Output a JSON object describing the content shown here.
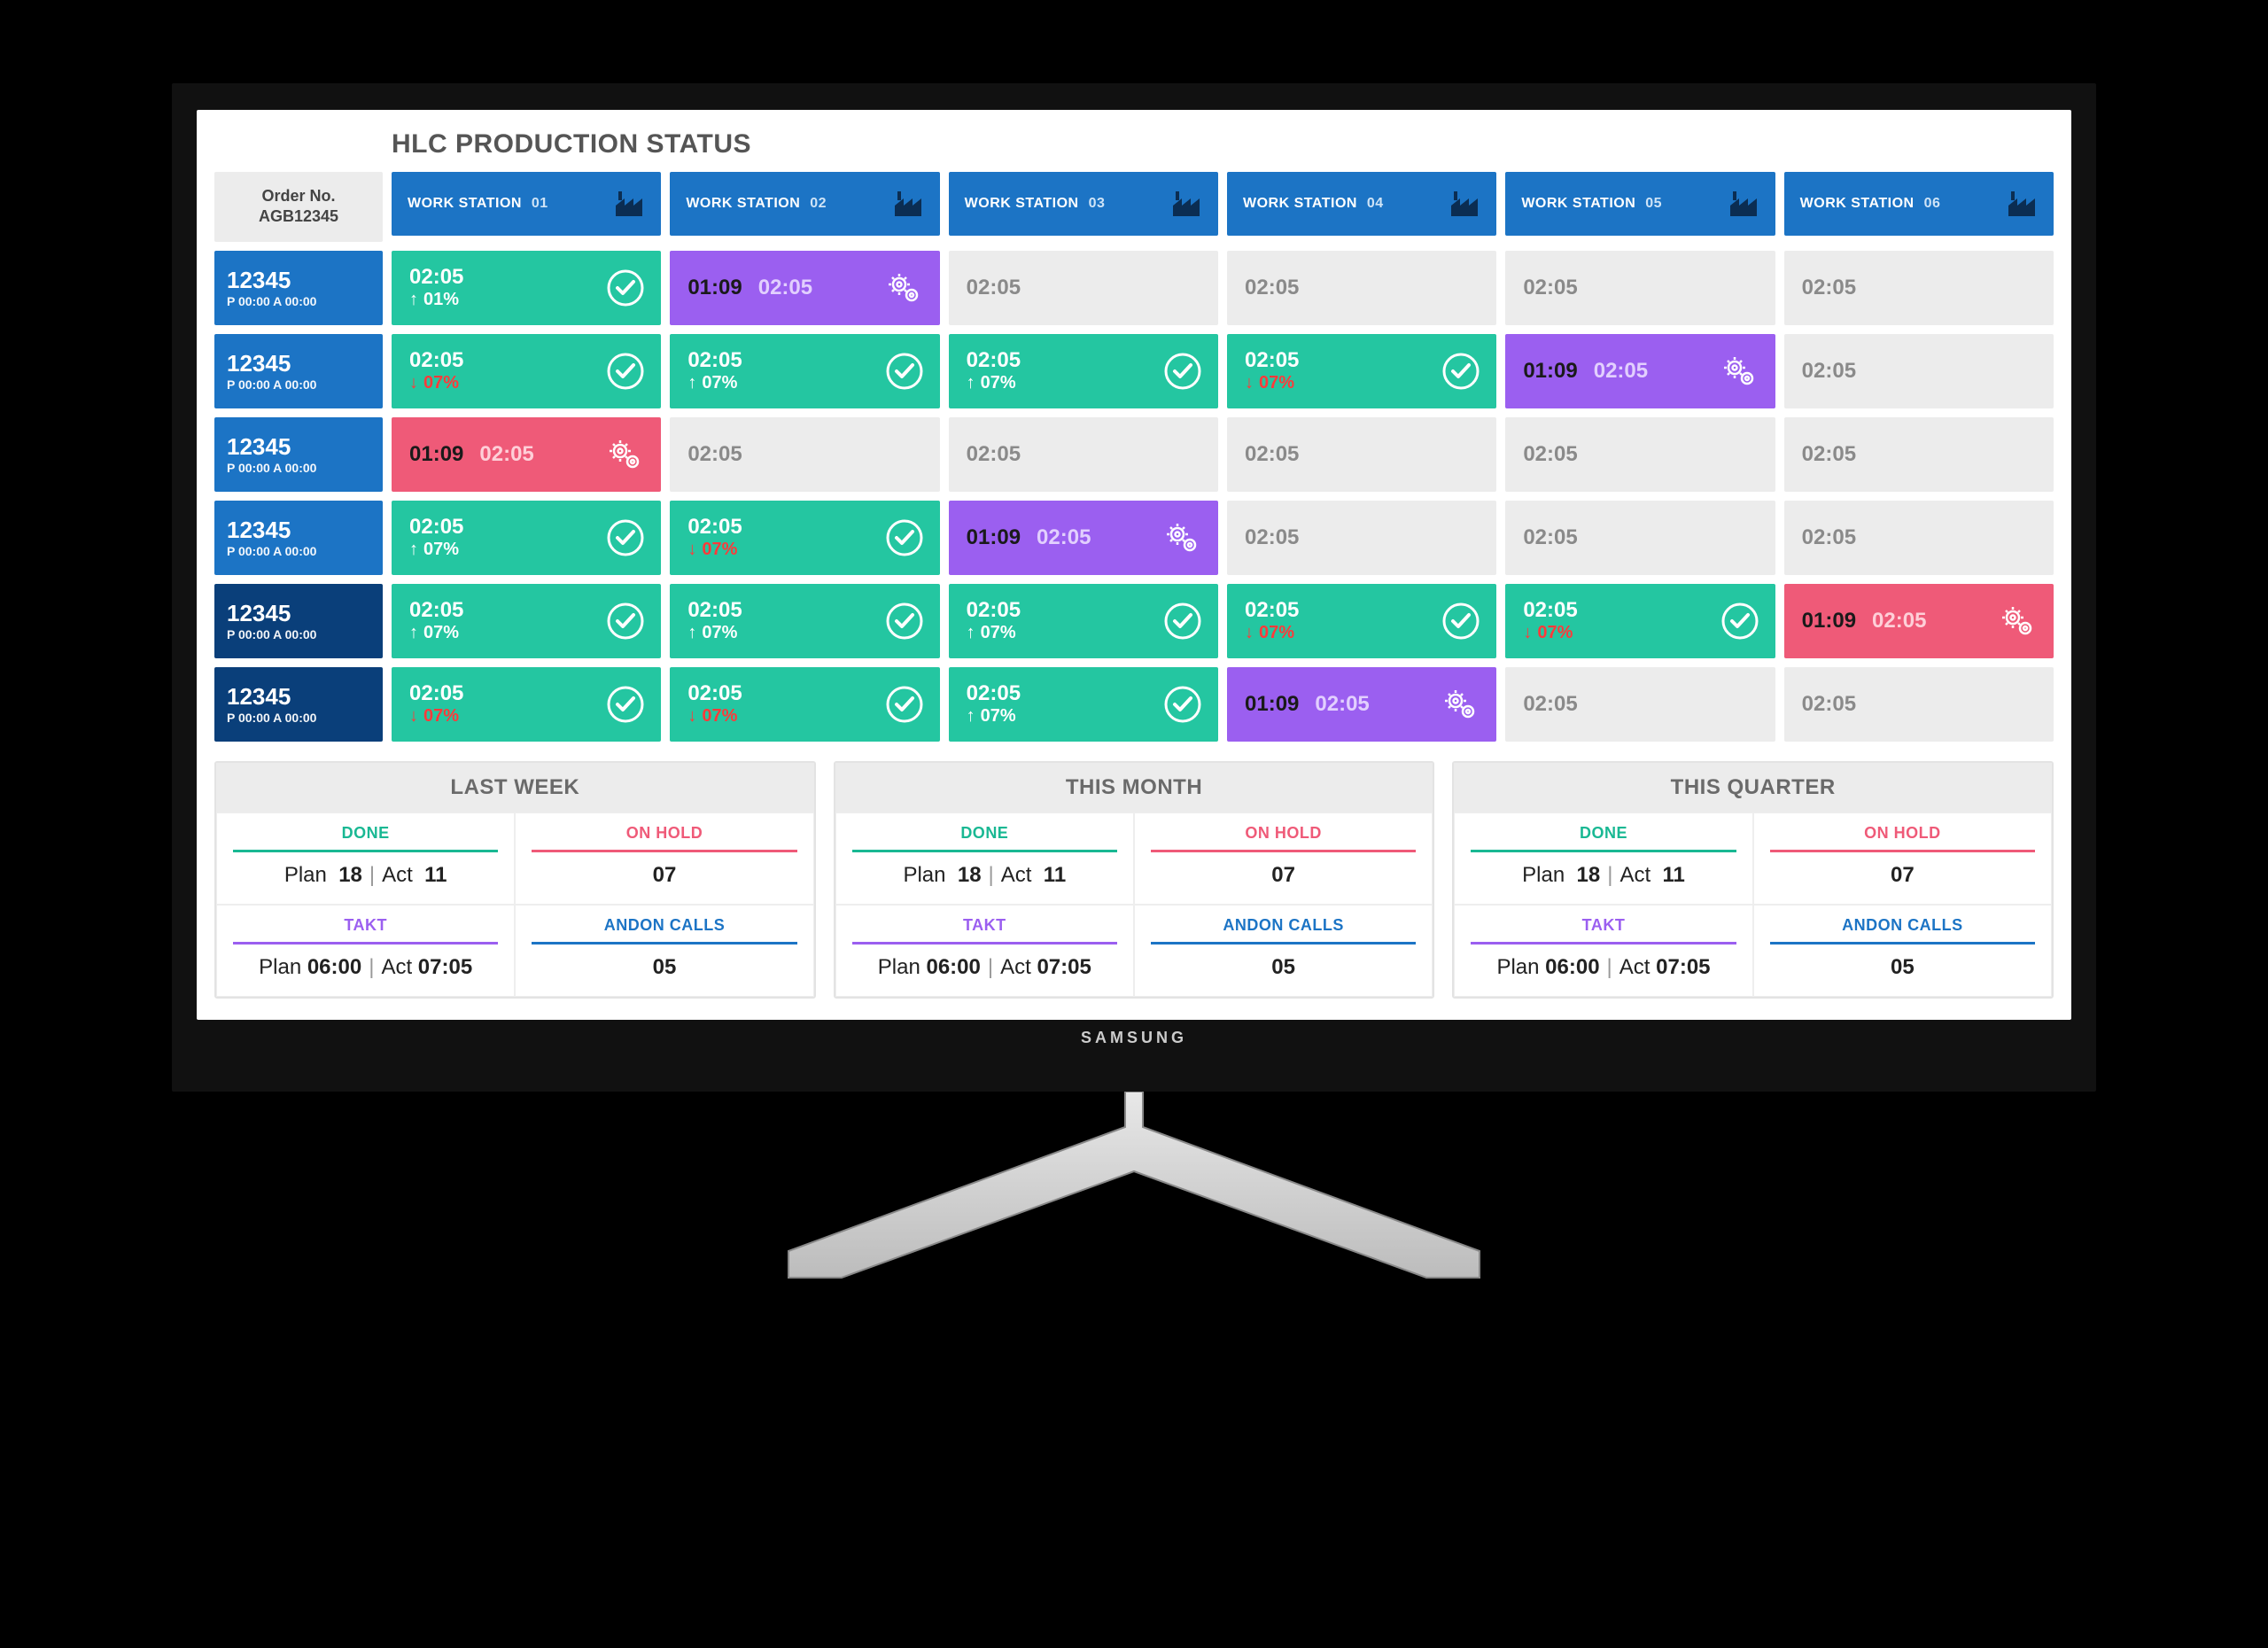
{
  "title": "HLC PRODUCTION STATUS",
  "orderHeader": {
    "l1": "Order No.",
    "l2": "AGB12345"
  },
  "stations": [
    {
      "label": "WORK STATION",
      "num": "01"
    },
    {
      "label": "WORK STATION",
      "num": "02"
    },
    {
      "label": "WORK STATION",
      "num": "03"
    },
    {
      "label": "WORK STATION",
      "num": "04"
    },
    {
      "label": "WORK STATION",
      "num": "05"
    },
    {
      "label": "WORK STATION",
      "num": "06"
    }
  ],
  "rows": [
    {
      "dark": false,
      "id": "12345",
      "sub": "P 00:00 A 00:00",
      "cells": [
        {
          "type": "green",
          "time": "02:05",
          "pct": "01%",
          "dir": "up"
        },
        {
          "type": "purple",
          "a": "01:09",
          "b": "02:05"
        },
        {
          "type": "idle",
          "time": "02:05"
        },
        {
          "type": "idle",
          "time": "02:05"
        },
        {
          "type": "idle",
          "time": "02:05"
        },
        {
          "type": "idle",
          "time": "02:05"
        }
      ]
    },
    {
      "dark": false,
      "id": "12345",
      "sub": "P 00:00 A 00:00",
      "cells": [
        {
          "type": "green",
          "time": "02:05",
          "pct": "07%",
          "dir": "down"
        },
        {
          "type": "green",
          "time": "02:05",
          "pct": "07%",
          "dir": "up"
        },
        {
          "type": "green",
          "time": "02:05",
          "pct": "07%",
          "dir": "up"
        },
        {
          "type": "green",
          "time": "02:05",
          "pct": "07%",
          "dir": "down"
        },
        {
          "type": "purple",
          "a": "01:09",
          "b": "02:05"
        },
        {
          "type": "idle",
          "time": "02:05"
        }
      ]
    },
    {
      "dark": false,
      "id": "12345",
      "sub": "P 00:00 A 00:00",
      "cells": [
        {
          "type": "red",
          "a": "01:09",
          "b": "02:05"
        },
        {
          "type": "idle",
          "time": "02:05"
        },
        {
          "type": "idle",
          "time": "02:05"
        },
        {
          "type": "idle",
          "time": "02:05"
        },
        {
          "type": "idle",
          "time": "02:05"
        },
        {
          "type": "idle",
          "time": "02:05"
        }
      ]
    },
    {
      "dark": false,
      "id": "12345",
      "sub": "P 00:00 A 00:00",
      "cells": [
        {
          "type": "green",
          "time": "02:05",
          "pct": "07%",
          "dir": "up"
        },
        {
          "type": "green",
          "time": "02:05",
          "pct": "07%",
          "dir": "down"
        },
        {
          "type": "purple",
          "a": "01:09",
          "b": "02:05"
        },
        {
          "type": "idle",
          "time": "02:05"
        },
        {
          "type": "idle",
          "time": "02:05"
        },
        {
          "type": "idle",
          "time": "02:05"
        }
      ]
    },
    {
      "dark": true,
      "id": "12345",
      "sub": "P 00:00 A 00:00",
      "cells": [
        {
          "type": "green",
          "time": "02:05",
          "pct": "07%",
          "dir": "up"
        },
        {
          "type": "green",
          "time": "02:05",
          "pct": "07%",
          "dir": "up"
        },
        {
          "type": "green",
          "time": "02:05",
          "pct": "07%",
          "dir": "up"
        },
        {
          "type": "green",
          "time": "02:05",
          "pct": "07%",
          "dir": "down"
        },
        {
          "type": "green",
          "time": "02:05",
          "pct": "07%",
          "dir": "down"
        },
        {
          "type": "red",
          "a": "01:09",
          "b": "02:05"
        }
      ]
    },
    {
      "dark": true,
      "id": "12345",
      "sub": "P 00:00 A 00:00",
      "cells": [
        {
          "type": "green",
          "time": "02:05",
          "pct": "07%",
          "dir": "down"
        },
        {
          "type": "green",
          "time": "02:05",
          "pct": "07%",
          "dir": "down"
        },
        {
          "type": "green",
          "time": "02:05",
          "pct": "07%",
          "dir": "up"
        },
        {
          "type": "purple",
          "a": "01:09",
          "b": "02:05"
        },
        {
          "type": "idle",
          "time": "02:05"
        },
        {
          "type": "idle",
          "time": "02:05"
        }
      ]
    }
  ],
  "summary": [
    {
      "title": "LAST WEEK",
      "done": {
        "label": "DONE",
        "planLabel": "Plan",
        "plan": "18",
        "actLabel": "Act",
        "act": "11"
      },
      "hold": {
        "label": "ON HOLD",
        "value": "07"
      },
      "takt": {
        "label": "TAKT",
        "planLabel": "Plan",
        "plan": "06:00",
        "actLabel": "Act",
        "act": "07:05"
      },
      "andon": {
        "label": "ANDON CALLS",
        "value": "05"
      }
    },
    {
      "title": "THIS MONTH",
      "done": {
        "label": "DONE",
        "planLabel": "Plan",
        "plan": "18",
        "actLabel": "Act",
        "act": "11"
      },
      "hold": {
        "label": "ON HOLD",
        "value": "07"
      },
      "takt": {
        "label": "TAKT",
        "planLabel": "Plan",
        "plan": "06:00",
        "actLabel": "Act",
        "act": "07:05"
      },
      "andon": {
        "label": "ANDON CALLS",
        "value": "05"
      }
    },
    {
      "title": "THIS QUARTER",
      "done": {
        "label": "DONE",
        "planLabel": "Plan",
        "plan": "18",
        "actLabel": "Act",
        "act": "11"
      },
      "hold": {
        "label": "ON HOLD",
        "value": "07"
      },
      "takt": {
        "label": "TAKT",
        "planLabel": "Plan",
        "plan": "06:00",
        "actLabel": "Act",
        "act": "07:05"
      },
      "andon": {
        "label": "ANDON CALLS",
        "value": "05"
      }
    }
  ],
  "brand": "SAMSUNG"
}
